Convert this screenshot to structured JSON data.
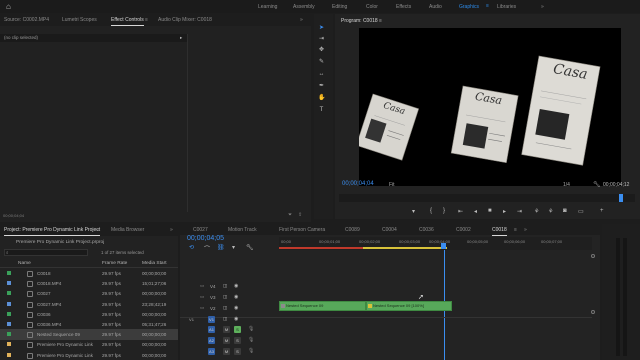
{
  "workspaces": {
    "items": [
      "Learning",
      "Assembly",
      "Editing",
      "Color",
      "Effects",
      "Audio",
      "Graphics",
      "Libraries"
    ],
    "active": "Graphics",
    "more": "»"
  },
  "source_panel": {
    "tabs": [
      "Source: C0002.MP4",
      "Lumetri Scopes",
      "Effect Controls",
      "Audio Clip Mixer: C0018"
    ],
    "active_tab": "Effect Controls",
    "menu_glyph": "≡",
    "more": "»",
    "no_clip": "(no clip selected)",
    "timecode": "00;00;04;04"
  },
  "program_monitor": {
    "title": "Program: C0018",
    "menu_glyph": "≡",
    "timecode": "00;00;04;04",
    "fit": "Fit",
    "resolution": "1/4",
    "duration": "00;00;04;12",
    "video_text": [
      "Casa",
      "Casa",
      "Casa"
    ]
  },
  "project_panel": {
    "tabs": [
      "Project: Premiere Pro Dynamic Link Project",
      "Media Browser"
    ],
    "menu_glyph": "≡",
    "more": "»",
    "path": "Premiere Pro Dynamic Link Project.prproj",
    "items_selected": "1 of 27 items selected",
    "columns": [
      "Name",
      "Frame Rate",
      "Media Start"
    ],
    "rows": [
      {
        "name": "C0018",
        "rate": "29.97 fps",
        "start": "00;00;00;00",
        "color": "#3aa05a"
      },
      {
        "name": "C0018.MP4",
        "rate": "29.97 fps",
        "start": "15;01;27;06",
        "color": "#5b8fd6"
      },
      {
        "name": "C0027",
        "rate": "29.97 fps",
        "start": "00;00;00;00",
        "color": "#3aa05a"
      },
      {
        "name": "C0027.MP4",
        "rate": "29.97 fps",
        "start": "23;28;42;19",
        "color": "#5b8fd6"
      },
      {
        "name": "C0036",
        "rate": "29.97 fps",
        "start": "00;00;00;00",
        "color": "#3aa05a"
      },
      {
        "name": "C0036.MP4",
        "rate": "29.97 fps",
        "start": "05;31;47;26",
        "color": "#5b8fd6"
      },
      {
        "name": "Nested Sequence 09",
        "rate": "29.97 fps",
        "start": "00;00;00;00",
        "color": "#3aa05a"
      },
      {
        "name": "Premiere Pro Dynamic Link",
        "rate": "29.97 fps",
        "start": "00;00;00;00",
        "color": "#e0b15a"
      },
      {
        "name": "Premiere Pro Dynamic Link",
        "rate": "29.97 fps",
        "start": "00;00;00;00",
        "color": "#e0b15a"
      }
    ],
    "selected_row": 6
  },
  "timeline": {
    "tabs": [
      "C0027",
      "Motion Track",
      "First Person Camera",
      "C0089",
      "C0004",
      "C0036",
      "C0002",
      "C0018"
    ],
    "active_tab": "C0018",
    "menu_glyph": "≡",
    "more": "»",
    "timecode": "00;00;04;05",
    "ruler": [
      "00;00",
      "00;00;01;00",
      "00;00;02;00",
      "00;00;03;00",
      "00;00;04;00",
      "00;00;05;00",
      "00;00;06;00",
      "00;00;07;00"
    ],
    "video_tracks": [
      "V4",
      "V3",
      "V2",
      "V1"
    ],
    "audio_tracks": [
      "A1",
      "A2",
      "A3"
    ],
    "clip_1": "Nested Sequence 09",
    "clip_2": "Nested Sequence 09 [100%]",
    "track_controls": [
      "M",
      "S"
    ]
  }
}
